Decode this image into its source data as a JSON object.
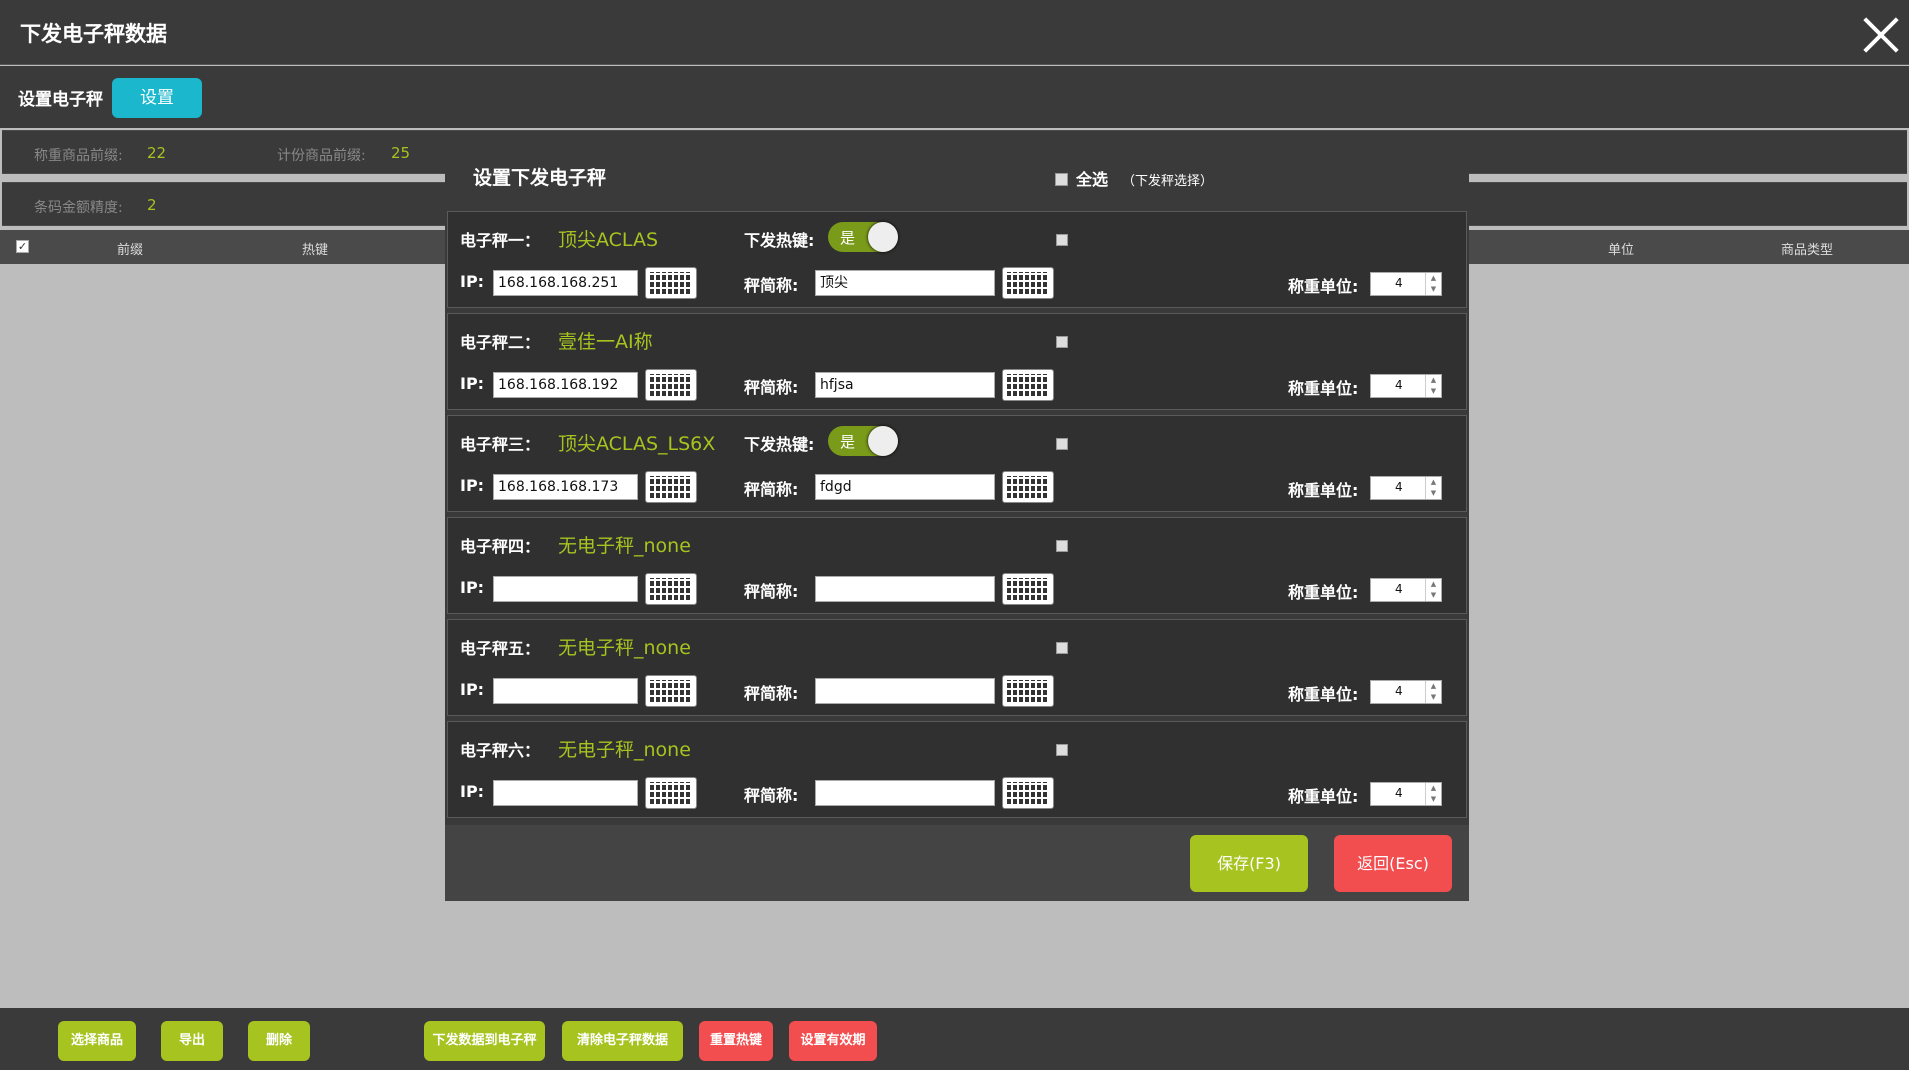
{
  "window": {
    "title": "下发电子秤数据"
  },
  "set_row": {
    "label": "设置电子秤",
    "button": "设置"
  },
  "info1": {
    "weigh_prefix_label": "称重商品前缀:",
    "weigh_prefix_value": "22",
    "count_prefix_label": "计份商品前缀:",
    "count_prefix_value": "25"
  },
  "info2": {
    "precision_label": "条码金额精度:",
    "precision_value": "2"
  },
  "table_header": {
    "check": "✓",
    "col_prefix": "前缀",
    "col_hotkey": "热键",
    "col_unit": "单位",
    "col_type": "商品类型"
  },
  "bottom_toolbar": {
    "select_goods": "选择商品",
    "export": "导出",
    "delete": "删除",
    "send_to_scale": "下发数据到电子秤",
    "clear_scale": "清除电子秤数据",
    "reset_hotkey": "重置热键",
    "set_validity": "设置有效期"
  },
  "modal": {
    "title": "设置下发电子秤",
    "select_all": "全选",
    "select_hint": "（下发秤选择）",
    "hotkey_label": "下发热键:",
    "toggle_yes": "是",
    "ip_label": "IP:",
    "short_name_label": "秤简称:",
    "unit_label": "称重单位:",
    "save_button": "保存(F3)",
    "back_button": "返回(Esc)",
    "scales": [
      {
        "name": "电子秤一：",
        "model": "顶尖ACLAS",
        "hotkey": true,
        "ip": "168.168.168.251",
        "short": "顶尖",
        "unit": "4"
      },
      {
        "name": "电子秤二：",
        "model": "壹佳一AI称",
        "hotkey": false,
        "ip": "168.168.168.192",
        "short": "hfjsa",
        "unit": "4"
      },
      {
        "name": "电子秤三：",
        "model": "顶尖ACLAS_LS6X",
        "hotkey": true,
        "ip": "168.168.168.173",
        "short": "fdgd",
        "unit": "4"
      },
      {
        "name": "电子秤四：",
        "model": "无电子秤_none",
        "hotkey": false,
        "ip": "",
        "short": "",
        "unit": "4"
      },
      {
        "name": "电子秤五：",
        "model": "无电子秤_none",
        "hotkey": false,
        "ip": "",
        "short": "",
        "unit": "4"
      },
      {
        "name": "电子秤六：",
        "model": "无电子秤_none",
        "hotkey": false,
        "ip": "",
        "short": "",
        "unit": "4"
      }
    ]
  },
  "colors": {
    "accent_green": "#a6c31f",
    "accent_red": "#f24d4f",
    "accent_cyan": "#1ab7cd"
  }
}
